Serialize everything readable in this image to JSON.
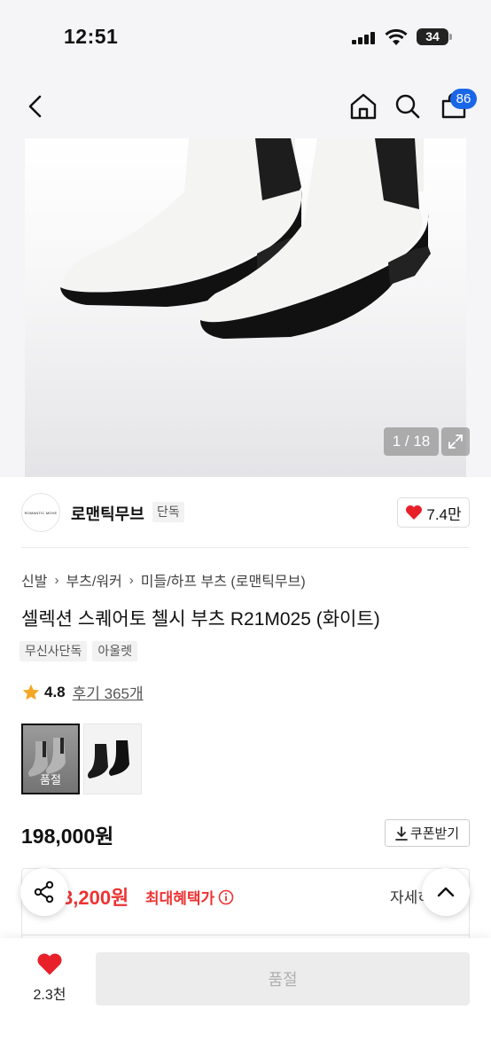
{
  "status_bar": {
    "time": "12:51",
    "battery": "34"
  },
  "header": {
    "cart_count": "86"
  },
  "gallery": {
    "counter": "1 / 18"
  },
  "brand": {
    "logo_text": "ROMANTIC MOVE",
    "name": "로맨틱무브",
    "tag": "단독",
    "likes": "7.4만"
  },
  "breadcrumb": [
    "신발",
    "부츠/워커",
    "미들/하프 부츠 (로맨틱무브)"
  ],
  "product": {
    "title": "셀렉션 스퀘어토 첼시 부츠 R21M025 (화이트)",
    "tags": [
      "무신사단독",
      "아울렛"
    ],
    "rating": "4.8",
    "reviews": "후기 365개",
    "soldout_label": "품절",
    "price": "198,000원"
  },
  "coupon": {
    "label": "쿠폰받기"
  },
  "benefit": {
    "price": "3,200원",
    "label": "최대혜택가",
    "detail": "자세히"
  },
  "bottom_bar": {
    "wish_count": "2.3천",
    "buy_label": "품절"
  },
  "colors": {
    "accent": "#1a66e8",
    "sale_red": "#e33333",
    "heart": "#e8202a"
  }
}
